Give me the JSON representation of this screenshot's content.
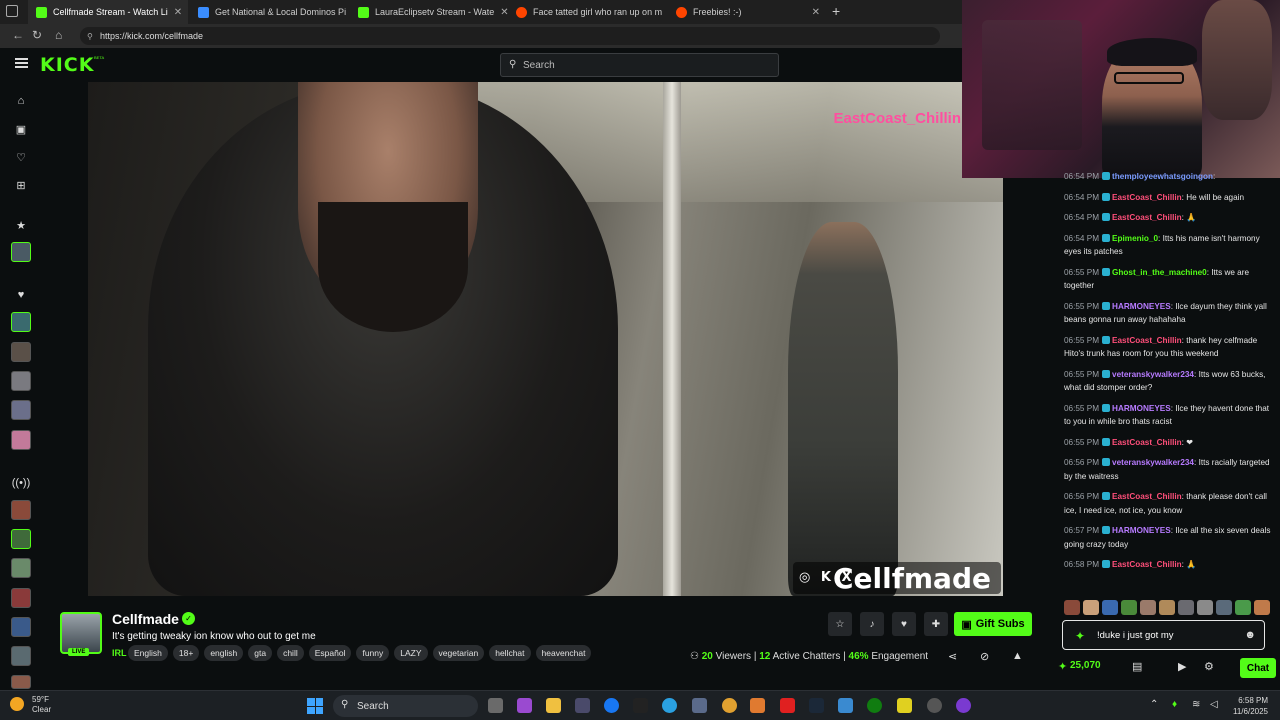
{
  "browser": {
    "tabs": [
      {
        "label": "Cellfmade Stream - Watch Li",
        "active": true,
        "favicon_color": "#53fc18"
      },
      {
        "label": "Get National & Local Dominos Pi",
        "active": false,
        "favicon_color": "#3a8dff"
      },
      {
        "label": "LauraEclipsetv Stream - Wate",
        "active": false,
        "favicon_color": "#53fc18"
      },
      {
        "label": "Face tatted girl who ran up on m",
        "active": false,
        "favicon_color": "#ff4500"
      },
      {
        "label": "Freebies! :-)",
        "active": false,
        "favicon_color": "#ff4500"
      }
    ],
    "new_tab": "+",
    "url": "https://kick.com/cellfmade"
  },
  "kick": {
    "logo": "KICK",
    "logo_badge": "BETA",
    "search_placeholder": "Search",
    "accent": "#53fc18"
  },
  "video": {
    "watermark": "EastCoast_Chillin",
    "overlay_icons": "◎ K X",
    "overlay_name": "Cellfmade"
  },
  "stream": {
    "channel": "Cellfmade",
    "verified": "✓",
    "live": "LIVE",
    "title": "It's getting tweaky ion know who out to get me",
    "category": "IRL",
    "tags": [
      "English",
      "18+",
      "english",
      "gta",
      "chill",
      "Español",
      "funny",
      "LAZY",
      "vegetarian",
      "hellchat",
      "heavenchat"
    ],
    "gift_label": "Gift Subs",
    "viewers": "20",
    "viewers_label": "Viewers",
    "chatters": "12",
    "chatters_label": "Active Chatters",
    "engagement": "46%",
    "engagement_label": "Engagement"
  },
  "chat": {
    "messages": [
      {
        "time": "06:54 PM",
        "user": "themployeewhatsgoingon",
        "color": "#7b9cff",
        "text": ""
      },
      {
        "time": "06:54 PM",
        "user": "EastCoast_Chillin",
        "color": "#ff4f7a",
        "text": "He will be again"
      },
      {
        "time": "06:54 PM",
        "user": "EastCoast_Chillin",
        "color": "#ff4f7a",
        "text": "🙏"
      },
      {
        "time": "06:54 PM",
        "user": "Epimenio_0",
        "color": "#53fc18",
        "text": "Itts his name isn't harmony eyes its patches"
      },
      {
        "time": "06:55 PM",
        "user": "Ghost_in_the_machine0",
        "color": "#53fc18",
        "text": "Itts we are together"
      },
      {
        "time": "06:55 PM",
        "user": "HARMONEYES",
        "color": "#b77bff",
        "text": "Ilce dayum they think yall beans gonna run away hahahaha"
      },
      {
        "time": "06:55 PM",
        "user": "EastCoast_Chillin",
        "color": "#ff4f7a",
        "text": "thank hey celfmade Hito's trunk has room for you this weekend"
      },
      {
        "time": "06:55 PM",
        "user": "veteranskywalker234",
        "color": "#b77bff",
        "text": "Itts wow 63 bucks, what did stomper order?"
      },
      {
        "time": "06:55 PM",
        "user": "HARMONEYES",
        "color": "#b77bff",
        "text": "Ilce they havent done that to you in while bro thats racist"
      },
      {
        "time": "06:55 PM",
        "user": "EastCoast_Chillin",
        "color": "#ff4f7a",
        "text": "❤"
      },
      {
        "time": "06:56 PM",
        "user": "veteranskywalker234",
        "color": "#b77bff",
        "text": "Itts racially targeted by the waitress"
      },
      {
        "time": "06:56 PM",
        "user": "EastCoast_Chillin",
        "color": "#ff4f7a",
        "text": "thank please don't call ice, I need ice, not ice, you know"
      },
      {
        "time": "06:57 PM",
        "user": "HARMONEYES",
        "color": "#b77bff",
        "text": "Ilce all the six seven deals going crazy today"
      },
      {
        "time": "06:58 PM",
        "user": "EastCoast_Chillin",
        "color": "#ff4f7a",
        "text": "🙏"
      }
    ],
    "input_value": "!duke i just got my",
    "points": "25,070",
    "send_label": "Chat"
  },
  "taskbar": {
    "temp": "59°F",
    "weather": "Clear",
    "search": "Search",
    "time": "6:58 PM",
    "date": "11/6/2025"
  }
}
